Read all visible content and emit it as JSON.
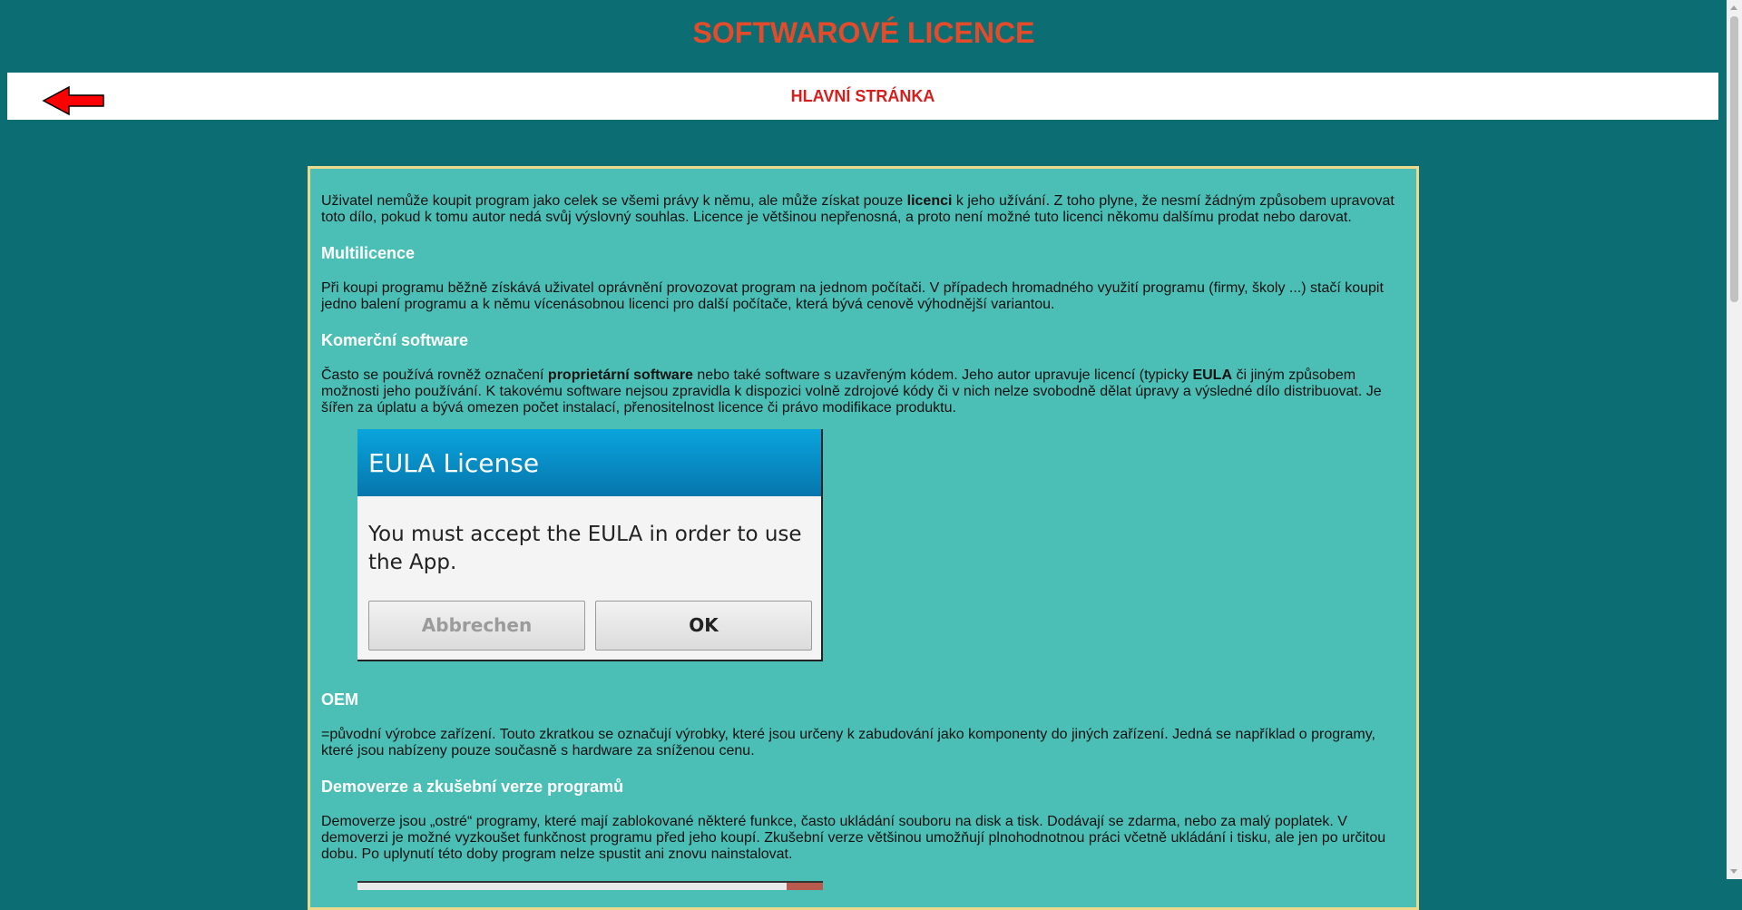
{
  "page": {
    "title": "SOFTWAROVÉ LICENCE"
  },
  "nav": {
    "back_icon": "left-arrow-icon",
    "home_label": "HLAVNÍ STRÁNKA"
  },
  "colors": {
    "background": "#0c6e73",
    "content_bg": "#4bbfb5",
    "content_border": "#ecd98b",
    "title": "#e34b2a",
    "nav_link": "#d61e1e",
    "heading": "#ffffff"
  },
  "intro": {
    "t1": "Uživatel nemůže koupit program jako celek se všemi právy k němu, ale může získat pouze ",
    "b1": "licenci",
    "t2": " k jeho užívání. Z toho plyne, že nesmí žádným způsobem upravovat toto dílo, pokud k tomu autor nedá svůj výslovný souhlas. Licence je většinou nepřenosná, a proto není možné tuto licenci někomu dalšímu prodat nebo darovat."
  },
  "multilicence": {
    "heading": "Multilicence",
    "text": "Při koupi programu běžně získává uživatel oprávnění provozovat program na jednom počítači. V případech hromadného využití programu (firmy, školy ...) stačí koupit jedno balení programu a k němu vícenásobnou licenci pro další počítače, která bývá cenově výhodnější variantou."
  },
  "commercial": {
    "heading": "Komerční software",
    "t1": "Často se používá rovněž označení ",
    "b1": "proprietární software",
    "t2": " nebo také software s uzavřeným kódem. Jeho autor upravuje licencí (typicky ",
    "b2": "EULA",
    "t3": " či jiným způsobem možnosti jeho používání. K takovému software nejsou zpravidla k dispozici volně zdrojové kódy či v nich nelze svobodně dělat úpravy a výsledné dílo distribuovat. Je šířen za úplatu a bývá omezen počet instalací, přenositelnost licence či právo modifikace produktu."
  },
  "eula_image": {
    "title": "EULA License",
    "message": "You must accept the EULA in order to use the App.",
    "cancel_label": "Abbrechen",
    "ok_label": "OK"
  },
  "oem": {
    "heading": "OEM",
    "text": "=původní výrobce zařízení. Touto zkratkou se označují výrobky, které jsou určeny k zabudování jako komponenty do jiných zařízení. Jedná se například o programy, které jsou nabízeny pouze současně s hardware za sníženou cenu."
  },
  "demo": {
    "heading": "Demoverze a zkušební verze programů",
    "text": "Demoverze jsou „ostré“ programy, které mají zablokované některé funkce, často ukládání souboru na disk a tisk. Dodávají se zdarma, nebo za malý poplatek. V demoverzi je možné vyzkoušet funkčnost programu před jeho koupí. Zkušební verze většinou umožňují plnohodnotnou práci včetně ukládání i tisku, ale jen po určitou dobu. Po uplynutí této doby program nelze spustit ani znovu nainstalovat."
  }
}
